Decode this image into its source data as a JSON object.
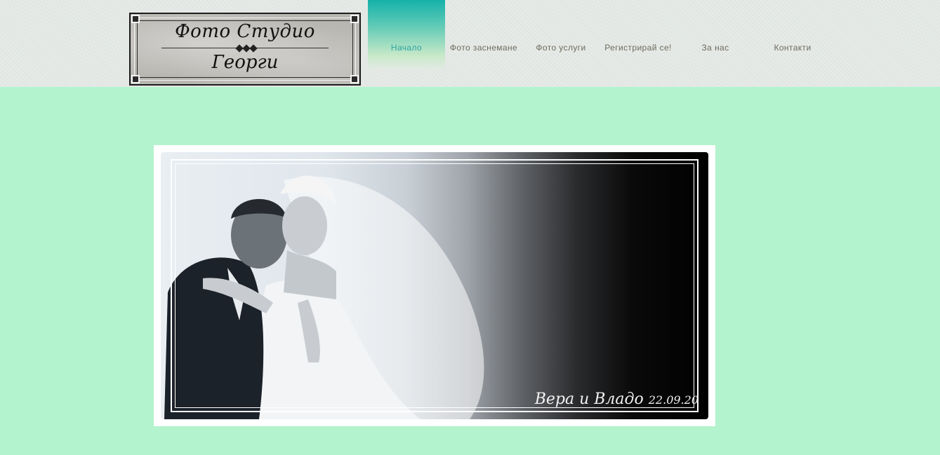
{
  "header": {
    "logo": {
      "line1": "Фото Студио",
      "line2": "Георги"
    },
    "nav": [
      {
        "label": "Начало",
        "active": true
      },
      {
        "label": "Фото заснемане",
        "active": false
      },
      {
        "label": "Фото услуги",
        "active": false
      },
      {
        "label": "Регистрирай се!",
        "active": false
      },
      {
        "label": "За нас",
        "active": false
      },
      {
        "label": "Контакти",
        "active": false
      }
    ]
  },
  "main": {
    "photo": {
      "caption_names": "Вера и Владо",
      "caption_date": "22.09.20"
    }
  },
  "colors": {
    "page_background": "#b3f3cd",
    "header_background": "#e4e9e6",
    "nav_active": "#16b1aa",
    "nav_text": "#6f6a5c"
  }
}
